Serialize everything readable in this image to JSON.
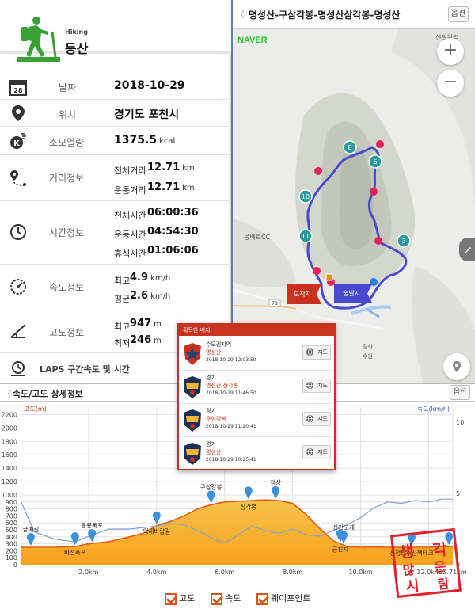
{
  "header": {
    "category_en": "Hiking",
    "category_ko": "등산"
  },
  "info": {
    "date_label": "날짜",
    "date": "2018-10-29",
    "location_label": "위치",
    "location": "경기도 포천시",
    "calorie_label": "소모열량",
    "calorie": "1375.5",
    "calorie_unit": "kcal",
    "distance_label": "거리정보",
    "total_distance_label": "전체거리",
    "total_distance": "12.71",
    "total_distance_unit": "km",
    "move_distance_label": "운동거리",
    "move_distance": "12.71",
    "move_distance_unit": "km",
    "time_label": "시간정보",
    "total_time_label": "전체시간",
    "total_time": "06:00:36",
    "move_time_label": "운동시간",
    "move_time": "04:54:30",
    "rest_time_label": "휴식시간",
    "rest_time": "01:06:06",
    "speed_label": "속도정보",
    "max_speed_label": "최고",
    "max_speed": "4.9",
    "max_speed_unit": "km/h",
    "avg_speed_label": "평균",
    "avg_speed": "2.6",
    "avg_speed_unit": "km/h",
    "altitude_label": "고도정보",
    "max_alt_label": "최고",
    "max_alt": "947",
    "max_alt_unit": "m",
    "min_alt_label": "최저",
    "min_alt": "246",
    "min_alt_unit": "m",
    "laps_label": "LAPS 구간속도 및 시간"
  },
  "map": {
    "back": "〈",
    "title": "명성산-구삼각봉-명성산삼각봉-명성산",
    "option": "옵션",
    "provider": "NAVER",
    "labels": {
      "golf": "몽베르CC",
      "finish": "도착지",
      "start": "출발지",
      "corner_top": "신철원리",
      "right1": "경화",
      "right2": "수원",
      "num_78": "78"
    },
    "waypoints": [
      "8",
      "6",
      "10",
      "11",
      "3"
    ],
    "zoom_in": "+",
    "zoom_out": "−",
    "accent_route": "#5a5ad6",
    "waypoint_color": "#2a9a9e"
  },
  "badges": {
    "title": "획득한 배지",
    "items": [
      {
        "type": "수도권지역",
        "name": "명성산",
        "time": "2018-10-29 12:03:59",
        "button": "지도"
      },
      {
        "type": "경기",
        "name": "명성산 삼각봉",
        "time": "2018-10-29 11:46:50",
        "button": "지도"
      },
      {
        "type": "경기",
        "name": "구삼각봉",
        "time": "2018-10-29 11:20:41",
        "button": "지도"
      },
      {
        "type": "경기",
        "name": "명성산",
        "time": "2018-10-29 10:25:41",
        "button": "지도"
      }
    ]
  },
  "detail": {
    "back": "〈",
    "title": "속도/고도 상세정보",
    "option": "옵션",
    "legend": {
      "altitude": "고도",
      "speed": "속도",
      "waypoint": "웨이포인트"
    },
    "stamp": [
      "생",
      "각",
      "많",
      "은",
      "시",
      "람"
    ]
  },
  "chart_data": {
    "type": "area",
    "xlabel": "",
    "ylabel_left": "고도(m)",
    "ylabel_right": "속도(km/h)",
    "x": [
      0,
      0.4,
      1.0,
      1.6,
      2.0,
      2.6,
      3.2,
      3.6,
      4.0,
      4.4,
      4.8,
      5.2,
      5.6,
      6.0,
      6.4,
      6.8,
      7.2,
      7.6,
      8.0,
      8.4,
      8.8,
      9.2,
      9.6,
      10.0,
      10.4,
      10.8,
      11.2,
      11.6,
      12.0,
      12.4,
      12.71
    ],
    "series": [
      {
        "name": "고도",
        "values": [
          250,
          250,
          250,
          260,
          300,
          330,
          400,
          450,
          560,
          620,
          700,
          800,
          860,
          900,
          910,
          920,
          930,
          920,
          880,
          720,
          520,
          340,
          260,
          250,
          255,
          250,
          250,
          250,
          250,
          260,
          260
        ]
      },
      {
        "name": "속도",
        "values": [
          4.5,
          2.3,
          1.8,
          1.6,
          2.0,
          2.5,
          2.5,
          2.6,
          2.7,
          2.9,
          2.8,
          2.4,
          1.9,
          1.5,
          2.1,
          2.7,
          2.4,
          2.2,
          2.5,
          2.1,
          2.0,
          2.4,
          2.8,
          3.3,
          4.0,
          4.4,
          4.3,
          4.5,
          4.4,
          4.6,
          4.6
        ]
      }
    ],
    "waypoints": [
      {
        "x": 0.3,
        "label": "궁예길"
      },
      {
        "x": 1.6,
        "label": "비선폭포"
      },
      {
        "x": 2.1,
        "label": "등룡폭포"
      },
      {
        "x": 4.0,
        "label": "억새바람길"
      },
      {
        "x": 5.6,
        "label": "구삼강봉"
      },
      {
        "x": 6.7,
        "label": "삼각봉"
      },
      {
        "x": 7.5,
        "label": "정상"
      },
      {
        "x": 9.4,
        "label": "궁진지"
      },
      {
        "x": 9.5,
        "label": "신안고개"
      },
      {
        "x": 11.5,
        "label": "산정호수산책데크"
      },
      {
        "x": 12.6,
        "label": ""
      }
    ],
    "yticks_left": [
      0,
      100,
      200,
      300,
      400,
      500,
      600,
      700,
      800,
      900,
      1000,
      1200,
      1400,
      1600,
      1800,
      2000,
      2200
    ],
    "yticks_right": [
      10,
      5,
      0
    ],
    "xticks": [
      2.0,
      4.0,
      6.0,
      8.0,
      10.0,
      12.0,
      12.71
    ],
    "xtick_labels": [
      "2.0km",
      "4.0km",
      "6.0km",
      "8.0km",
      "10.0km",
      "12.0km",
      "12.71km"
    ],
    "ylim_left": [
      0,
      2300
    ],
    "ylim_right": [
      0,
      11
    ],
    "grid": true,
    "colors": {
      "altitude_fill": "#f6c24a",
      "altitude_fill_bottom": "#f9a21c",
      "altitude_line": "#e45a12",
      "speed_line": "#7f9fd6",
      "waypoint_pin": "#3d8fe0"
    }
  }
}
